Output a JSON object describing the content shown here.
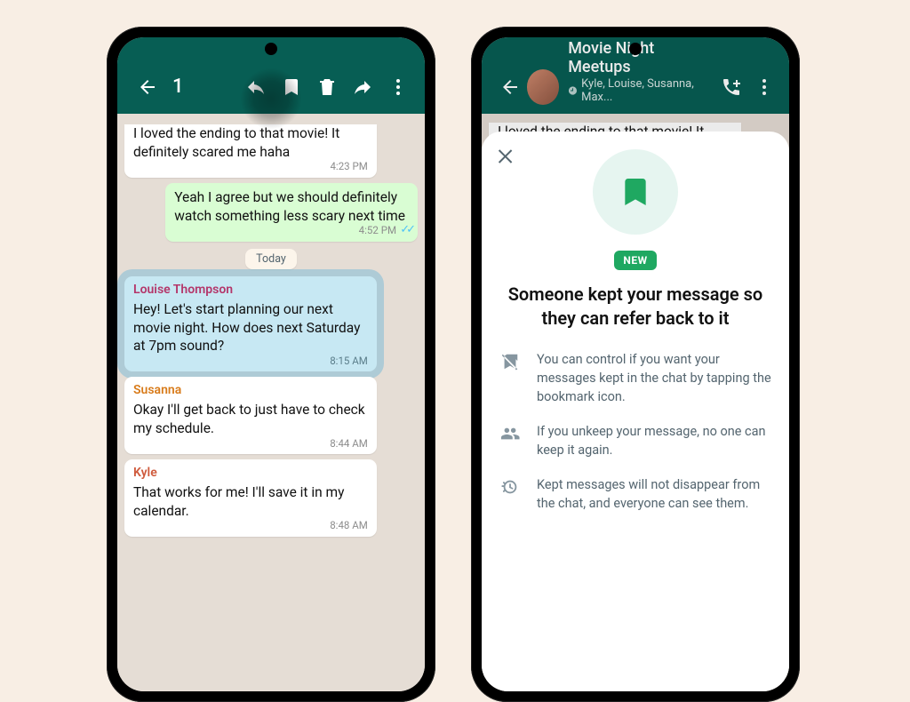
{
  "leftPhone": {
    "selectionCount": "1",
    "messagesTop": {
      "text": "I loved the ending to that movie! It definitely scared me haha",
      "time": "4:23 PM"
    },
    "outgoing": {
      "text": "Yeah I agree but we should definitely watch something less scary next time",
      "time": "4:52 PM"
    },
    "dateChip": "Today",
    "selected": {
      "sender": "Louise Thompson",
      "text": "Hey! Let's start planning our next movie night. How does next Saturday at 7pm sound?",
      "time": "8:15 AM"
    },
    "msg4": {
      "sender": "Susanna",
      "text": "Okay I'll get back to just have to check my schedule.",
      "time": "8:44 AM"
    },
    "msg5": {
      "sender": "Kyle",
      "text": "That works for me! I'll save it in my calendar.",
      "time": "8:48 AM"
    }
  },
  "rightPhone": {
    "chatTitle": "Movie Night Meetups",
    "chatSubtitle": "Kyle, Louise, Susanna, Max...",
    "peekMsg": "I loved the ending to that movie! It definitely scared me haha",
    "sheet": {
      "badge": "NEW",
      "title": "Someone kept your message so they can refer back to it",
      "bullet1": "You can control if you want your messages kept in the chat by tapping the bookmark icon.",
      "bullet2": "If you unkeep your message, no one can keep it again.",
      "bullet3": "Kept messages will not disappear from the chat, and everyone can see them."
    }
  }
}
